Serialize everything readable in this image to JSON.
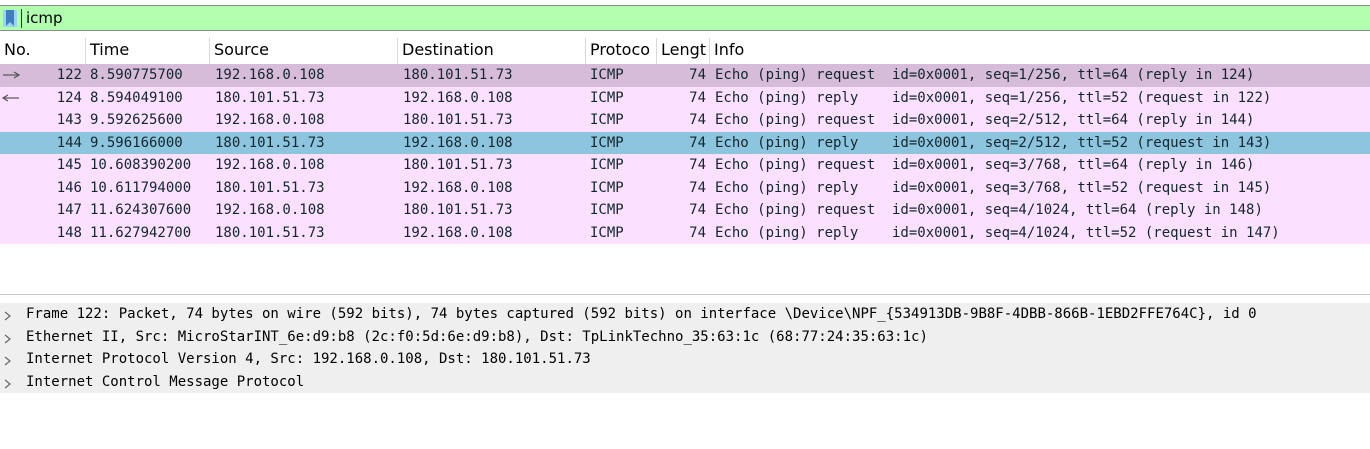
{
  "filter": {
    "value": "icmp"
  },
  "columns": [
    "No.",
    "Time",
    "Source",
    "Destination",
    "Protoco",
    "Lengt",
    "Info"
  ],
  "packets": [
    {
      "no": "122",
      "time": "8.590775700",
      "src": "192.168.0.108",
      "dst": "180.101.51.73",
      "proto": "ICMP",
      "len": "74",
      "info": "Echo (ping) request  id=0x0001, seq=1/256, ttl=64 (reply in 124)",
      "bg": "#d7bcd9",
      "dir": "out"
    },
    {
      "no": "124",
      "time": "8.594049100",
      "src": "180.101.51.73",
      "dst": "192.168.0.108",
      "proto": "ICMP",
      "len": "74",
      "info": "Echo (ping) reply    id=0x0001, seq=1/256, ttl=52 (request in 122)",
      "bg": "#fce0ff",
      "dir": "in"
    },
    {
      "no": "143",
      "time": "9.592625600",
      "src": "192.168.0.108",
      "dst": "180.101.51.73",
      "proto": "ICMP",
      "len": "74",
      "info": "Echo (ping) request  id=0x0001, seq=2/512, ttl=64 (reply in 144)",
      "bg": "#fce0ff",
      "dir": ""
    },
    {
      "no": "144",
      "time": "9.596166000",
      "src": "180.101.51.73",
      "dst": "192.168.0.108",
      "proto": "ICMP",
      "len": "74",
      "info": "Echo (ping) reply    id=0x0001, seq=2/512, ttl=52 (request in 143)",
      "bg": "#8ec5de",
      "dir": ""
    },
    {
      "no": "145",
      "time": "10.608390200",
      "src": "192.168.0.108",
      "dst": "180.101.51.73",
      "proto": "ICMP",
      "len": "74",
      "info": "Echo (ping) request  id=0x0001, seq=3/768, ttl=64 (reply in 146)",
      "bg": "#fce0ff",
      "dir": ""
    },
    {
      "no": "146",
      "time": "10.611794000",
      "src": "180.101.51.73",
      "dst": "192.168.0.108",
      "proto": "ICMP",
      "len": "74",
      "info": "Echo (ping) reply    id=0x0001, seq=3/768, ttl=52 (request in 145)",
      "bg": "#fce0ff",
      "dir": ""
    },
    {
      "no": "147",
      "time": "11.624307600",
      "src": "192.168.0.108",
      "dst": "180.101.51.73",
      "proto": "ICMP",
      "len": "74",
      "info": "Echo (ping) request  id=0x0001, seq=4/1024, ttl=64 (reply in 148)",
      "bg": "#fce0ff",
      "dir": ""
    },
    {
      "no": "148",
      "time": "11.627942700",
      "src": "180.101.51.73",
      "dst": "192.168.0.108",
      "proto": "ICMP",
      "len": "74",
      "info": "Echo (ping) reply    id=0x0001, seq=4/1024, ttl=52 (request in 147)",
      "bg": "#fce0ff",
      "dir": ""
    }
  ],
  "details": [
    "Frame 122: Packet, 74 bytes on wire (592 bits), 74 bytes captured (592 bits) on interface \\Device\\NPF_{534913DB-9B8F-4DBB-866B-1EBD2FFE764C}, id 0",
    "Ethernet II, Src: MicroStarINT_6e:d9:b8 (2c:f0:5d:6e:d9:b8), Dst: TpLinkTechno_35:63:1c (68:77:24:35:63:1c)",
    "Internet Protocol Version 4, Src: 192.168.0.108, Dst: 180.101.51.73",
    "Internet Control Message Protocol"
  ],
  "colors": {
    "filter_valid": "#afffaf",
    "row_icmp": "#fce0ff",
    "row_selected": "#8ec5de",
    "row_related": "#d7bcd9"
  },
  "icons": {
    "bookmark": "bookmark-icon",
    "expand": "chevron-right-icon",
    "direction_out": "arrow-right-icon",
    "direction_in": "arrow-left-icon"
  }
}
